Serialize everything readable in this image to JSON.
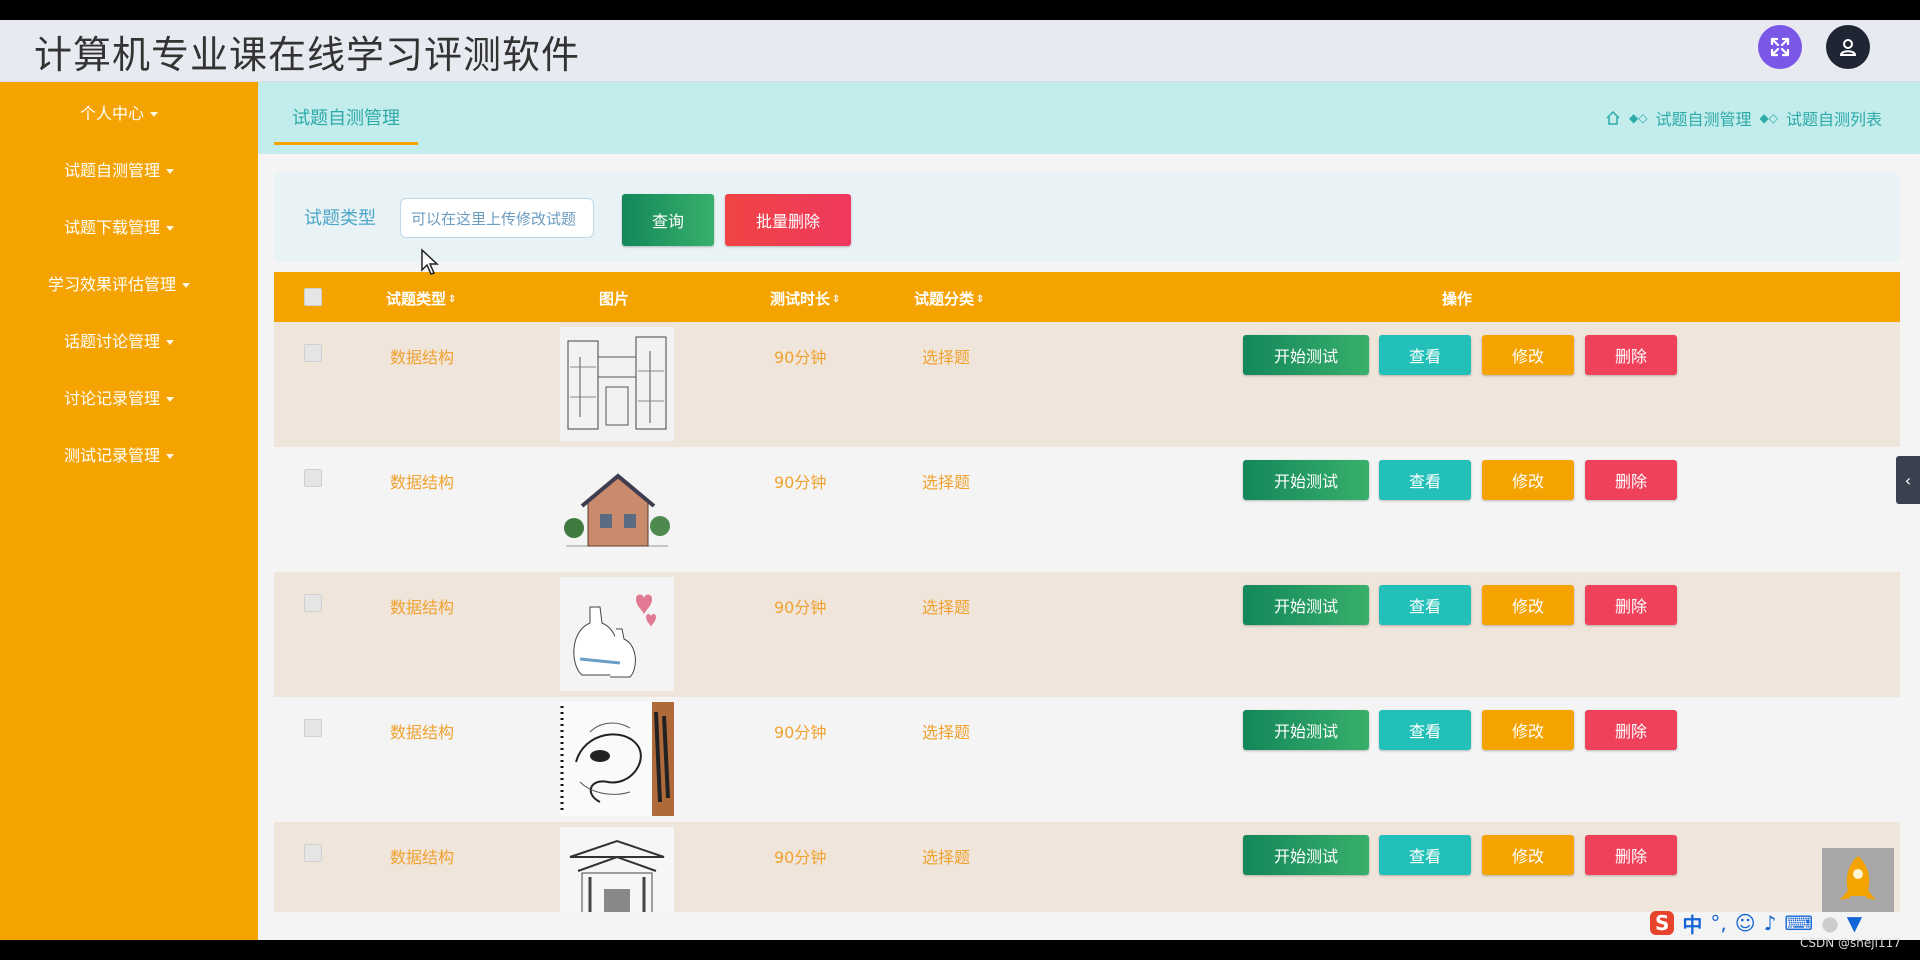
{
  "app": {
    "title": "计算机专业课在线学习评测软件"
  },
  "sidebar": {
    "items": [
      {
        "label": "个人中心"
      },
      {
        "label": "试题自测管理"
      },
      {
        "label": "试题下载管理"
      },
      {
        "label": "学习效果评估管理"
      },
      {
        "label": "话题讨论管理"
      },
      {
        "label": "讨论记录管理"
      },
      {
        "label": "测试记录管理"
      }
    ]
  },
  "subbar": {
    "tab": "试题自测管理",
    "breadcrumb": [
      "试题自测管理",
      "试题自测列表"
    ]
  },
  "search": {
    "label": "试题类型",
    "value": "可以在这里上传修改试题",
    "query_label": "查询",
    "batch_delete_label": "批量删除"
  },
  "table": {
    "headers": {
      "type": "试题类型",
      "image": "图片",
      "duration": "测试时长",
      "category": "试题分类",
      "actions": "操作"
    },
    "action_labels": {
      "start": "开始测试",
      "view": "查看",
      "edit": "修改",
      "delete": "删除"
    },
    "rows": [
      {
        "type": "数据结构",
        "duration": "90分钟",
        "category": "选择题",
        "image": "street-sketch"
      },
      {
        "type": "数据结构",
        "duration": "90分钟",
        "category": "选择题",
        "image": "house-sketch"
      },
      {
        "type": "数据结构",
        "duration": "90分钟",
        "category": "选择题",
        "image": "bottles-hearts-sketch"
      },
      {
        "type": "数据结构",
        "duration": "90分钟",
        "category": "选择题",
        "image": "dragon-sketch"
      },
      {
        "type": "数据结构",
        "duration": "90分钟",
        "category": "选择题",
        "image": "gate-sketch"
      }
    ]
  },
  "watermark": "CSDN @shejl117",
  "ime": {
    "mode": "中"
  },
  "colors": {
    "sidebar": "#f5a300",
    "accent": "#2eaaa8",
    "start": "#13875a",
    "view": "#22c0b8",
    "edit": "#f5a300",
    "delete": "#f0415a"
  }
}
